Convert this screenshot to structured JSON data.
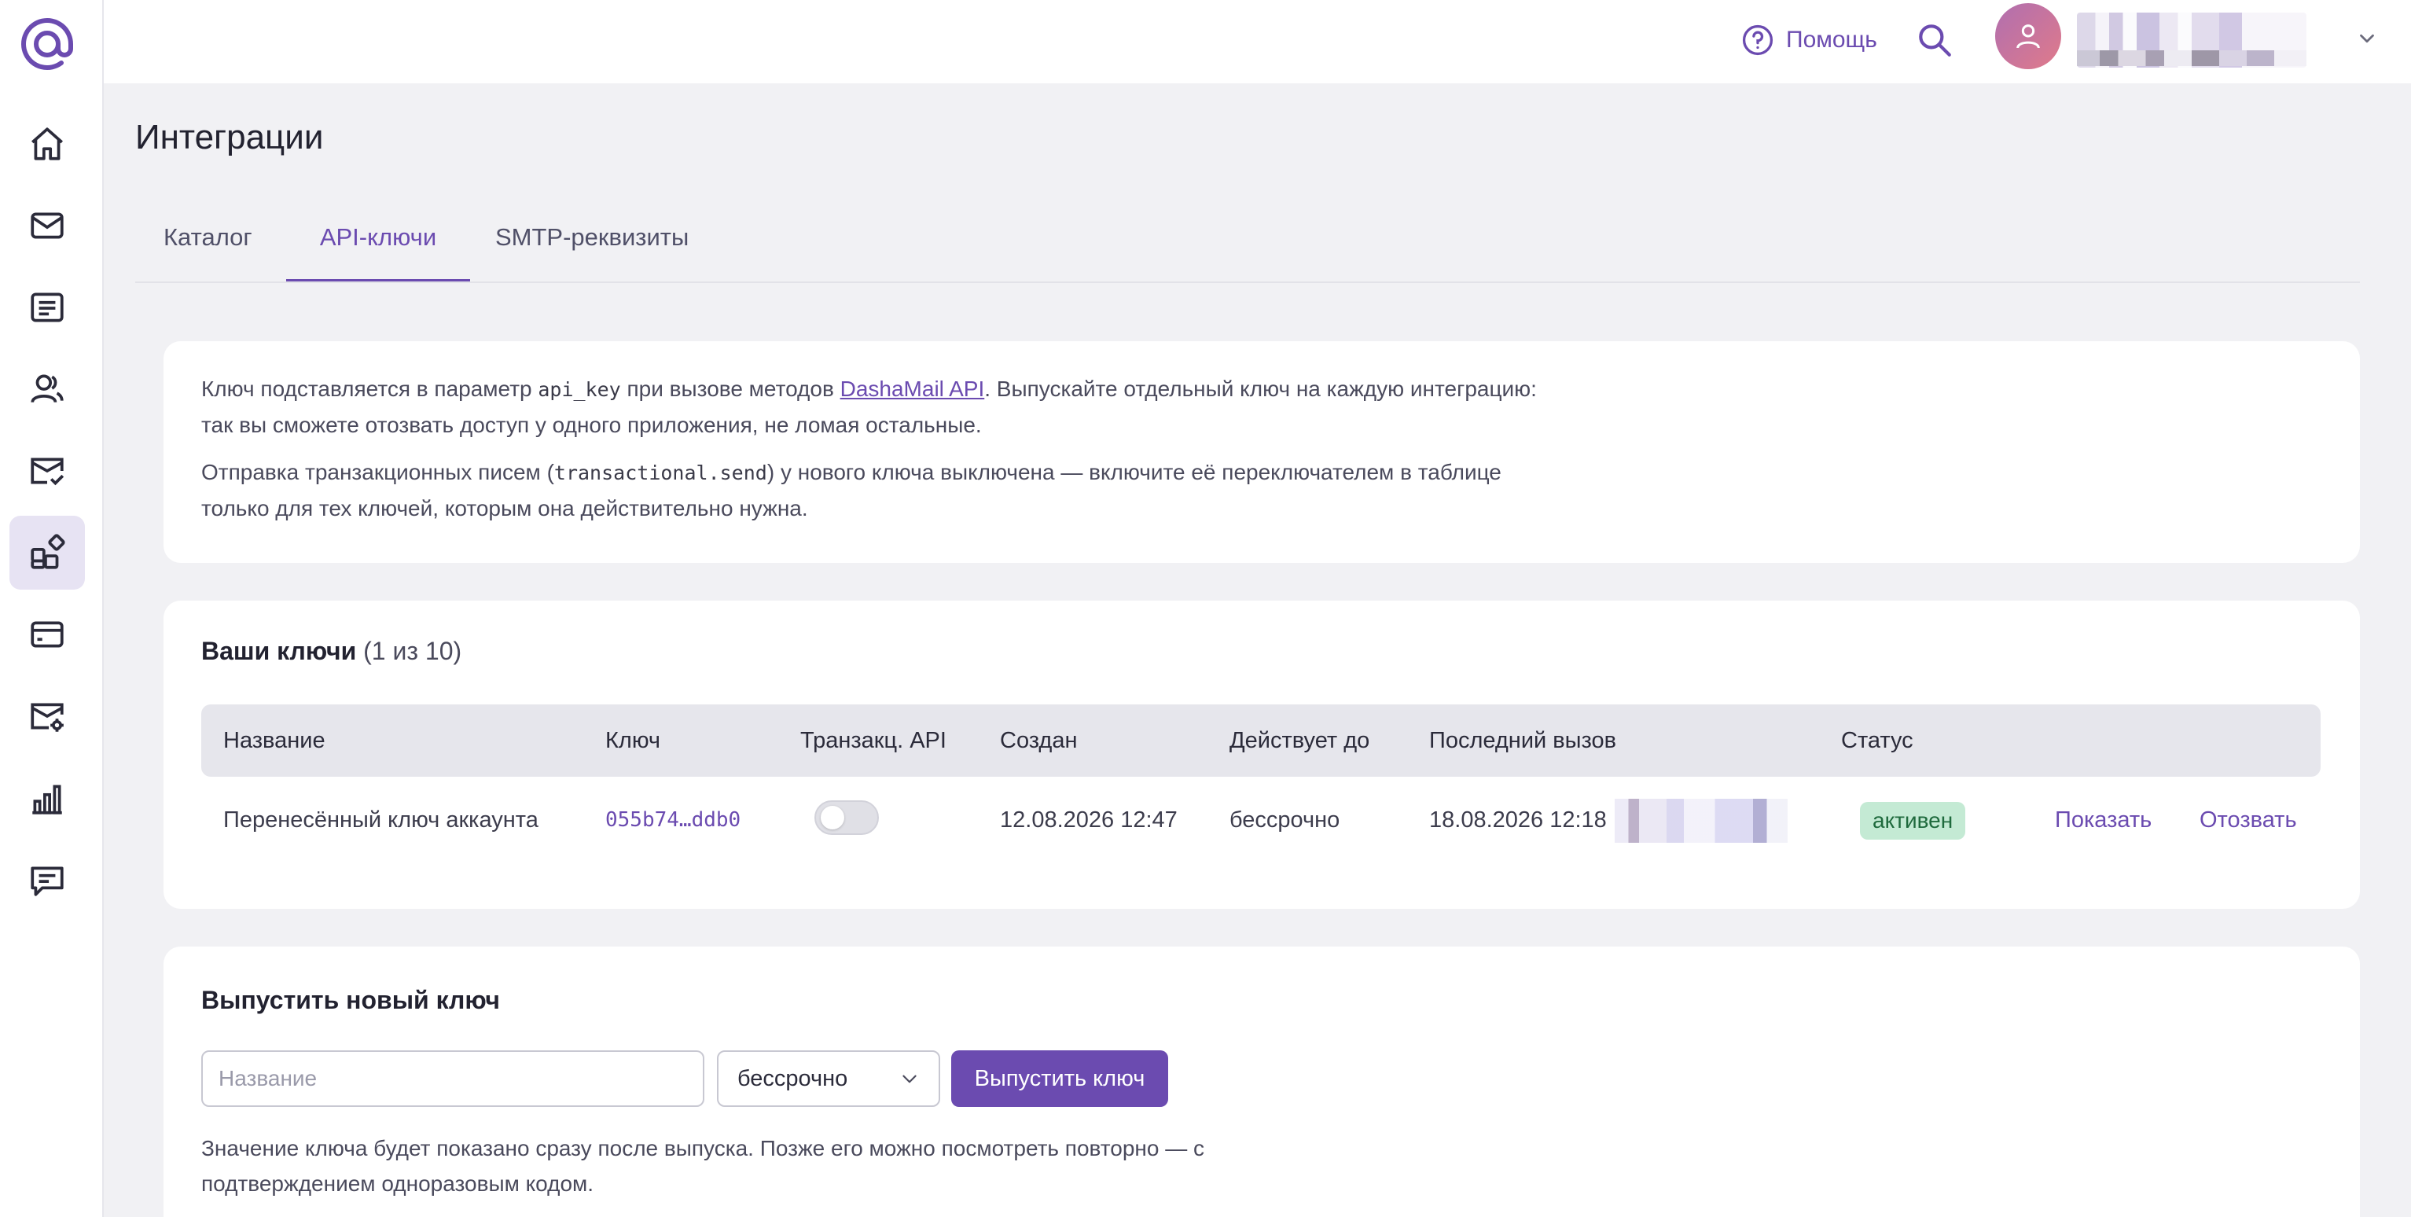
{
  "brand": {
    "logo_icon": "at-sign-icon",
    "accent": "#6b4bb0"
  },
  "sidebar": {
    "items": [
      {
        "name": "home",
        "icon": "home-icon"
      },
      {
        "name": "mail",
        "icon": "mail-icon"
      },
      {
        "name": "forms",
        "icon": "document-icon"
      },
      {
        "name": "contacts",
        "icon": "users-icon"
      },
      {
        "name": "automation",
        "icon": "mail-check-icon"
      },
      {
        "name": "integrations",
        "icon": "widgets-icon",
        "active": true
      },
      {
        "name": "billing",
        "icon": "card-icon"
      },
      {
        "name": "settings",
        "icon": "mail-settings-icon"
      },
      {
        "name": "stats",
        "icon": "bar-chart-icon"
      },
      {
        "name": "support",
        "icon": "chat-icon"
      }
    ]
  },
  "header": {
    "help_label": "Помощь"
  },
  "page": {
    "title": "Интеграции",
    "tabs": [
      {
        "label": "Каталог"
      },
      {
        "label": "API-ключи",
        "active": true
      },
      {
        "label": "SMTP-реквизиты"
      }
    ]
  },
  "info": {
    "p1_before": "Ключ подставляется в параметр ",
    "p1_code": "api_key",
    "p1_mid": " при вызове методов ",
    "p1_link": "DashaMail API",
    "p1_after": ". Выпускайте отдельный ключ на каждую интеграцию: так вы сможете отозвать доступ у одного приложения, не ломая остальные.",
    "p2_before": "Отправка транзакционных писем (",
    "p2_code": "transactional.send",
    "p2_after": ") у нового ключа выключена — включите её переключателем в таблице только для тех ключей, которым она действительно нужна."
  },
  "keys": {
    "title": "Ваши ключи",
    "count": "(1 из 10)",
    "columns": {
      "name": "Название",
      "key": "Ключ",
      "transact": "Транзакц. API",
      "created": "Создан",
      "valid_until": "Действует до",
      "last_call": "Последний вызов",
      "status": "Статус"
    },
    "rows": [
      {
        "name": "Перенесённый ключ аккаунта",
        "key": "055b74…ddb0",
        "transactional_enabled": false,
        "created": "12.08.2026 12:47",
        "valid_until": "бессрочно",
        "last_call": "18.08.2026 12:18",
        "status": "активен",
        "show_label": "Показать",
        "revoke_label": "Отозвать"
      }
    ]
  },
  "new_key": {
    "title": "Выпустить новый ключ",
    "name_placeholder": "Название",
    "name_value": "",
    "term_selected": "бессрочно",
    "submit_label": "Выпустить ключ",
    "hint": "Значение ключа будет показано сразу после выпуска. Позже его можно посмотреть повторно — с подтверждением одноразовым кодом."
  }
}
